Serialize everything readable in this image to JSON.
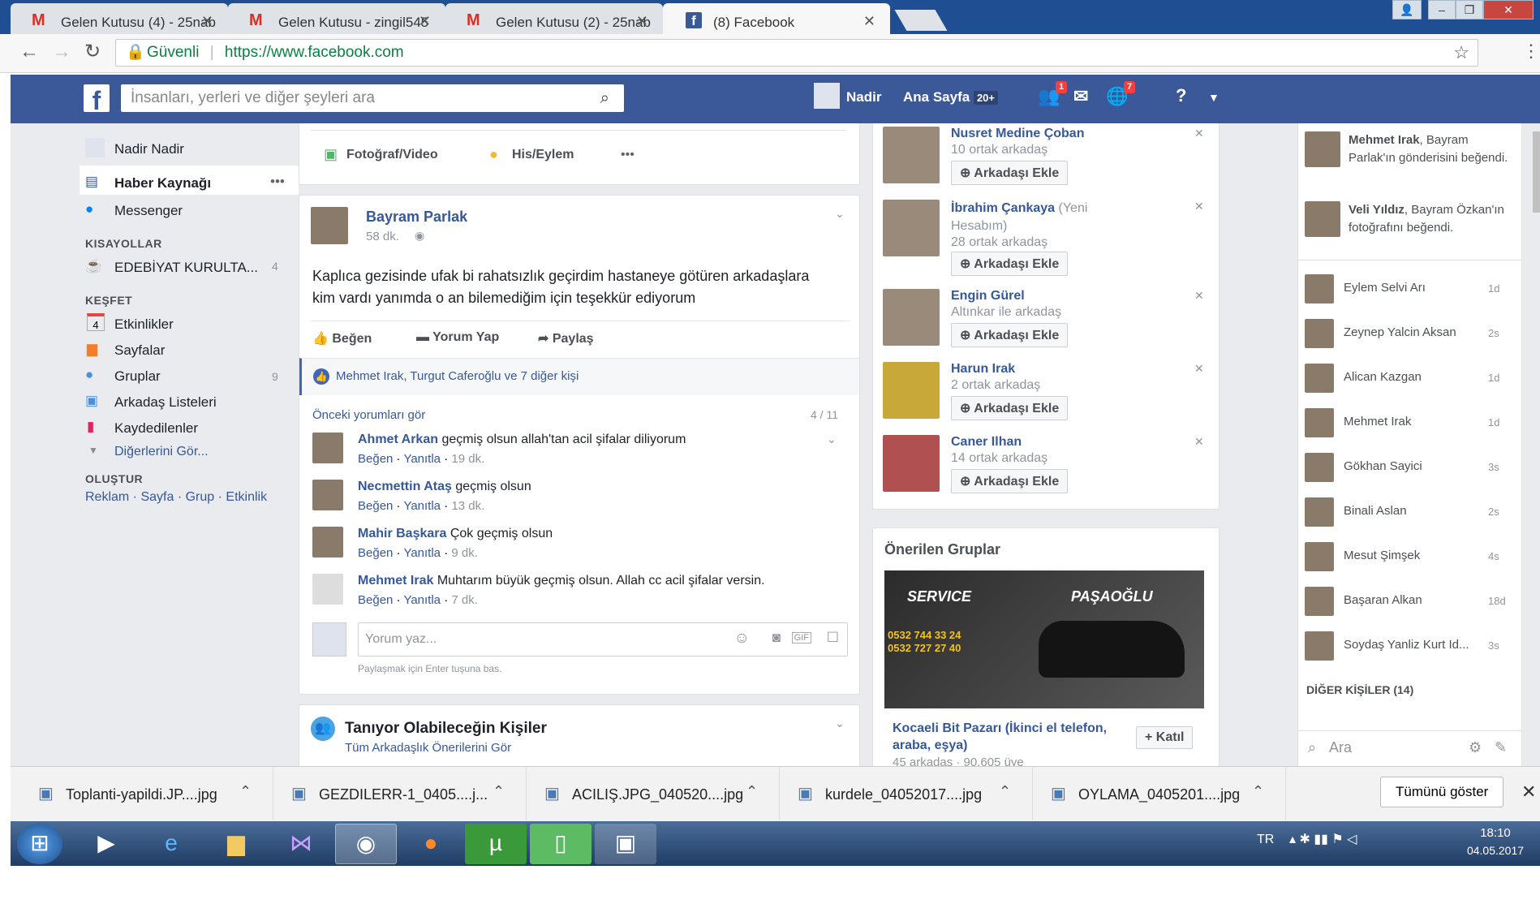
{
  "browser": {
    "tabs": [
      {
        "label": "Gelen Kutusu (4) - 25nab"
      },
      {
        "label": "Gelen Kutusu - zingil545"
      },
      {
        "label": "Gelen Kutusu (2) - 25nab"
      },
      {
        "label": "(8) Facebook"
      }
    ],
    "secure_label": "Güvenli",
    "url": "https://www.facebook.com"
  },
  "fb": {
    "search_placeholder": "İnsanları, yerleri ve diğer şeyleri ara",
    "user": "Nadir",
    "home": "Ana Sayfa",
    "home_count": "20+",
    "friend_badge": "1",
    "notif_badge": "7"
  },
  "left": {
    "profile": "Nadir Nadir",
    "news_feed": "Haber Kaynağı",
    "messenger": "Messenger",
    "shortcuts_title": "KISAYOLLAR",
    "shortcut": "EDEBİYAT KURULTA...",
    "shortcut_count": "4",
    "explore_title": "KEŞFET",
    "events_num": "4",
    "events": "Etkinlikler",
    "pages": "Sayfalar",
    "groups": "Gruplar",
    "groups_count": "9",
    "friend_lists": "Arkadaş Listeleri",
    "saved": "Kaydedilenler",
    "more": "Diğerlerini Gör...",
    "create_title": "OLUŞTUR",
    "create_links": [
      "Reklam",
      "Sayfa",
      "Grup",
      "Etkinlik"
    ]
  },
  "composer": {
    "photo": "Fotoğraf/Video",
    "feeling": "His/Eylem",
    "more": "•••"
  },
  "post": {
    "author": "Bayram Parlak",
    "time": "58 dk.",
    "text": "Kaplıca gezisinde ufak bi rahatsızlık geçirdim hastaneye götüren arkadaşlara kim vardı yanımda o an bilemediğim için teşekkür ediyorum",
    "like": "Beğen",
    "comment": "Yorum Yap",
    "share": "Paylaş",
    "likes": "Mehmet Irak, Turgut Caferoğlu ve 7 diğer kişi",
    "prev": "Önceki yorumları gör",
    "count": "4 / 11",
    "comments": [
      {
        "name": "Ahmet Arkan",
        "text": "geçmiş olsun allah'tan acil şifalar diliyorum",
        "time": "19 dk."
      },
      {
        "name": "Necmettin Ataş",
        "text": "geçmiş olsun",
        "time": "13 dk."
      },
      {
        "name": "Mahir Başkara",
        "text": "Çok geçmiş olsun",
        "time": "9 dk."
      },
      {
        "name": "Mehmet Irak",
        "text": "Muhtarım büyük geçmiş olsun. Allah cc acil şifalar versin.",
        "time": "7 dk."
      }
    ],
    "like_l": "Beğen",
    "reply": "Yanıtla",
    "write": "Yorum yaz...",
    "hint": "Paylaşmak için Enter tuşuna bas."
  },
  "pymk": {
    "title": "Tanıyor Olabileceğin Kişiler",
    "sub": "Tüm Arkadaşlık Önerilerini Gör"
  },
  "suggestions": [
    {
      "name": "Nusret Medine Çoban",
      "info": "10 ortak arkadaş"
    },
    {
      "name": "İbrahim Çankaya",
      "extra": "(Yeni Hesabım)",
      "info": "28 ortak arkadaş"
    },
    {
      "name": "Engin Gürel",
      "info": "Altınkar ile arkadaş"
    },
    {
      "name": "Harun Irak",
      "info": "2 ortak arkadaş"
    },
    {
      "name": "Caner Ilhan",
      "info": "14 ortak arkadaş"
    }
  ],
  "add_friend": "Arkadaşı Ekle",
  "groups": {
    "title": "Önerilen Gruplar",
    "banner1": "SERVICE",
    "banner2": "PAŞAOĞLU",
    "phone1": "0532 744 33 24",
    "phone2": "0532 727 27 40",
    "name": "Kocaeli Bit Pazarı (İkinci el telefon, araba, eşya)",
    "members": "45 arkadaş · 90.605 üye",
    "join": "+ Katıl"
  },
  "ticker": [
    {
      "name": "Mehmet Irak",
      "text": ", Bayram Parlak'ın gönderisini beğendi."
    },
    {
      "name": "Veli Yıldız",
      "text": ", Bayram Özkan'ın fotoğrafını beğendi."
    }
  ],
  "contacts": [
    {
      "name": "Eylem Selvi Arı",
      "t": "1d"
    },
    {
      "name": "Zeynep Yalcin Aksan",
      "t": "2s"
    },
    {
      "name": "Alican Kazgan",
      "t": "1d"
    },
    {
      "name": "Mehmet Irak",
      "t": "1d"
    },
    {
      "name": "Gökhan Sayici",
      "t": "3s"
    },
    {
      "name": "Binali Aslan",
      "t": "2s"
    },
    {
      "name": "Mesut Şimşek",
      "t": "4s"
    },
    {
      "name": "Başaran Alkan",
      "t": "18d"
    },
    {
      "name": "Soydaş Yanliz Kurt Id...",
      "t": "3s"
    }
  ],
  "other_people": "DİĞER KİŞİLER (14)",
  "chat_search": "Ara",
  "downloads": [
    "Toplanti-yapildi.JP....jpg",
    "GEZDILERR-1_0405....j...",
    "ACILIŞ.JPG_040520....jpg",
    "kurdele_04052017....jpg",
    "OYLAMA_0405201....jpg"
  ],
  "show_all": "Tümünü göster",
  "tray": {
    "lang": "TR",
    "time": "18:10",
    "date": "04.05.2017"
  }
}
